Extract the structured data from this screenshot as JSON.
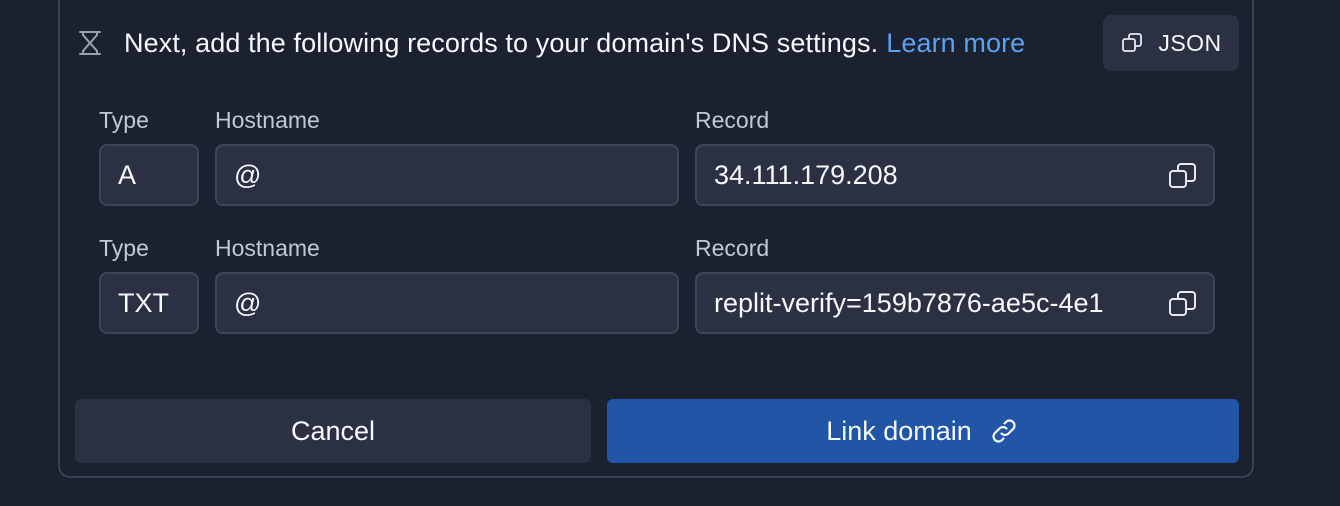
{
  "header": {
    "instruction": "Next, add the following records to your domain's DNS settings.",
    "learn_more": "Learn more",
    "json_label": "JSON"
  },
  "records": [
    {
      "type_label": "Type",
      "hostname_label": "Hostname",
      "record_label": "Record",
      "type": "A",
      "hostname": "@",
      "record": "34.111.179.208"
    },
    {
      "type_label": "Type",
      "hostname_label": "Hostname",
      "record_label": "Record",
      "type": "TXT",
      "hostname": "@",
      "record": "replit-verify=159b7876-ae5c-4e1"
    }
  ],
  "actions": {
    "cancel_label": "Cancel",
    "link_label": "Link domain"
  },
  "icons": {
    "header": "hourglass-icon",
    "json": "copy-icon",
    "record_copy": "copy-icon",
    "link": "chain-link-icon"
  },
  "colors": {
    "background": "#1c2130",
    "field": "#2b3142",
    "link_text": "#5aa2f2",
    "primary_button": "#2155a5"
  }
}
